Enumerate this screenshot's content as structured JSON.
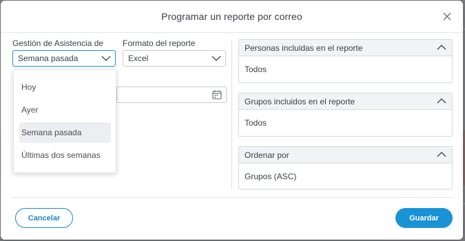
{
  "modal": {
    "title": "Programar un reporte por correo",
    "close_icon": "close-icon"
  },
  "form": {
    "range_label": "Gestión de Asistencia de",
    "range_value": "Semana pasada",
    "format_label": "Formato del reporte",
    "format_value": "Excel",
    "date_icon": "calendar-icon"
  },
  "range_dropdown": {
    "options": [
      "Hoy",
      "Ayer",
      "Semana pasada",
      "Últimas dos semanas"
    ],
    "selected": "Semana pasada"
  },
  "panels": [
    {
      "title": "Personas incluidas en el reporte",
      "value": "Todos"
    },
    {
      "title": "Grupos incluidos en el reporte",
      "value": "Todos"
    },
    {
      "title": "Ordenar por",
      "value": "Grupos (ASC)"
    }
  ],
  "footer": {
    "cancel_label": "Cancelar",
    "save_label": "Guardar"
  },
  "colors": {
    "accent": "#1a93d6",
    "focus_border": "#1f8fd6"
  }
}
